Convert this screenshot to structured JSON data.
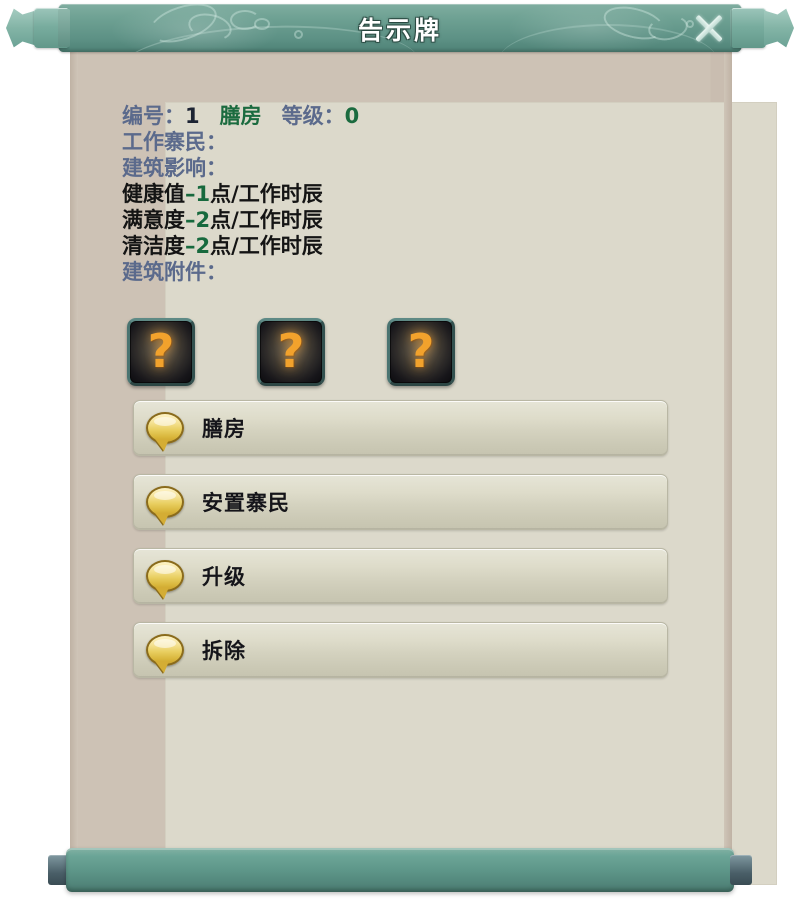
{
  "window": {
    "title": "告示牌",
    "close_icon": "close-x-icon"
  },
  "info": {
    "id_label": "编号：",
    "id_value": "1",
    "building_name": "膳房",
    "level_label": "等级：",
    "level_value": "0",
    "workers_label": "工作寨民：",
    "workers_value": "",
    "effects_label": "建筑影响：",
    "effects": [
      {
        "name": "健康值",
        "delta": "–1",
        "unit": "点/工作时辰"
      },
      {
        "name": "满意度",
        "delta": "–2",
        "unit": "点/工作时辰"
      },
      {
        "name": "清洁度",
        "delta": "–2",
        "unit": "点/工作时辰"
      }
    ],
    "accessories_label": "建筑附件："
  },
  "slots": [
    {
      "name": "accessory-slot-1",
      "glyph": "?",
      "state": "empty"
    },
    {
      "name": "accessory-slot-2",
      "glyph": "?",
      "state": "empty"
    },
    {
      "name": "accessory-slot-3",
      "glyph": "?",
      "state": "empty"
    }
  ],
  "buttons": [
    {
      "label": "膳房",
      "icon": "speech-bubble-icon"
    },
    {
      "label": "安置寨民",
      "icon": "speech-bubble-icon"
    },
    {
      "label": "升级",
      "icon": "speech-bubble-icon"
    },
    {
      "label": "拆除",
      "icon": "speech-bubble-icon"
    }
  ],
  "colors": {
    "titlebar_teal": "#5d9185",
    "roller_teal": "#5c9487",
    "panel_parchment": "#cbc0b3",
    "panel_inner": "#dcd9cb",
    "label_blue": "#5b6a8c",
    "value_green": "#1b6b3f",
    "effect_green": "#17693d",
    "slot_orange": "#f2a22c",
    "bubble_gold": "#e9cf62"
  }
}
